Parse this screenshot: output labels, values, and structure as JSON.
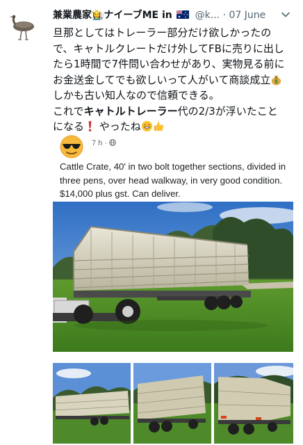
{
  "tweet": {
    "display_name": "兼業農家👩‍🌾ナイーブME in",
    "handle": "@k...",
    "separator": "·",
    "date": "07 June",
    "text_lines": [
      "旦那としてはトレーラー部分だけ欲しかったの",
      "で、キャトルクレートだけ外してFBに売りに出し",
      "たら1時間で7件問い合わせがあり、実物見る前に",
      "お金送金してでも欲しいって人がいて商談成立",
      "しかも古い知人なので信頼できる。"
    ],
    "line6_prefix": "これで",
    "line6_bold": "キャトルトレーラー",
    "line6_suffix": "代の2/3が浮いたこと",
    "line7_text_a": "になる",
    "line7_text_b": " やったね",
    "icons": {
      "avatar": "emu-icon",
      "flag": "australia-flag-icon",
      "more": "chevron-down-icon",
      "money": "money-bag-emoji",
      "exclaim": "red-exclamation-emoji",
      "grin": "grinning-face-emoji",
      "thumbs": "thumbs-up-emoji"
    },
    "colors": {
      "text": "#0f1419",
      "secondary": "#536471",
      "flag_blue": "#012169",
      "flag_red": "#c8102e"
    }
  },
  "fb_post": {
    "time": "7 h · ",
    "text": "Cattle Crate, 40' in two bolt together sections, divided in three pens, over head walkway, in very good condition. $14,000 plus gst. Can deliver.",
    "icons": {
      "avatar": "sunglasses-face-icon",
      "privacy": "globe-icon"
    },
    "photos": {
      "main": "cattle-crate-trailer-photo",
      "thumbs": [
        "trailer-side-photo",
        "trailer-rear-side-photo",
        "trailer-rear-photo"
      ]
    }
  }
}
